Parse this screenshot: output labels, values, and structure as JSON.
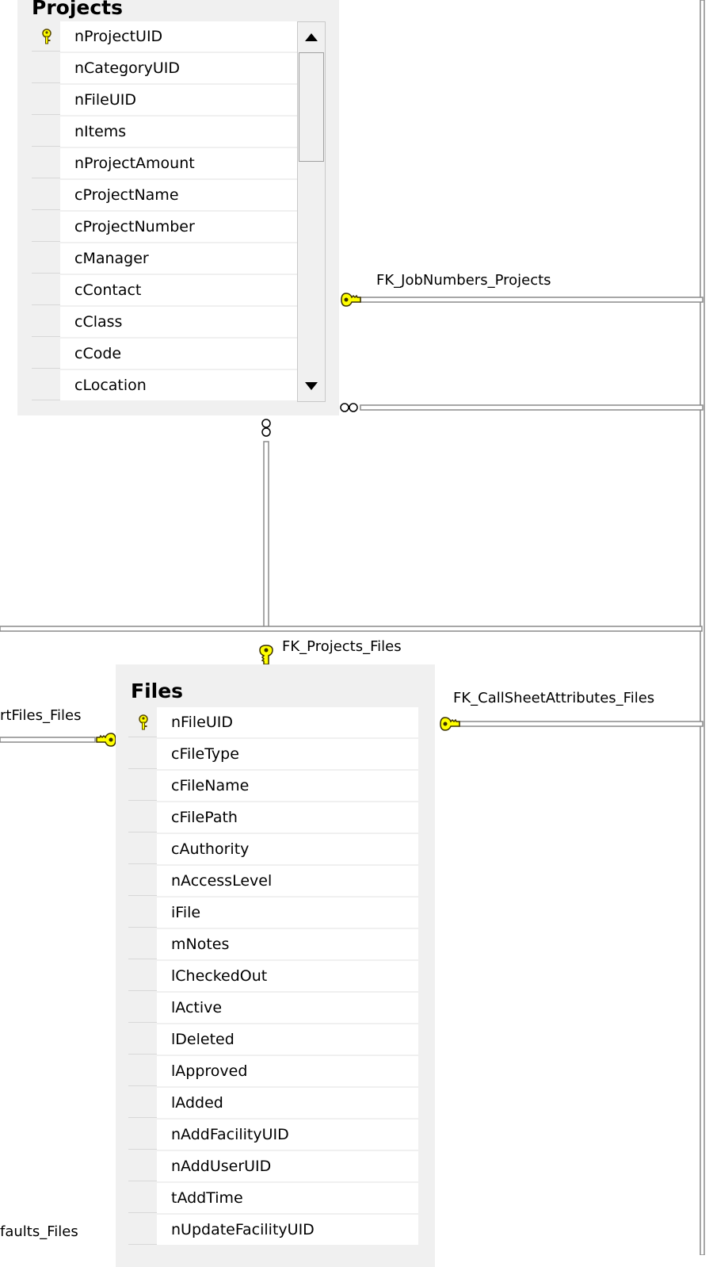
{
  "tables": {
    "projects": {
      "title": "Projects",
      "columns": [
        {
          "name": "nProjectUID",
          "key": true
        },
        {
          "name": "nCategoryUID",
          "key": false
        },
        {
          "name": "nFileUID",
          "key": false
        },
        {
          "name": "nItems",
          "key": false
        },
        {
          "name": "nProjectAmount",
          "key": false
        },
        {
          "name": "cProjectName",
          "key": false
        },
        {
          "name": "cProjectNumber",
          "key": false
        },
        {
          "name": "cManager",
          "key": false
        },
        {
          "name": "cContact",
          "key": false
        },
        {
          "name": "cClass",
          "key": false
        },
        {
          "name": "cCode",
          "key": false
        },
        {
          "name": "cLocation",
          "key": false
        }
      ]
    },
    "files": {
      "title": "Files",
      "columns": [
        {
          "name": "nFileUID",
          "key": true
        },
        {
          "name": "cFileType",
          "key": false
        },
        {
          "name": "cFileName",
          "key": false
        },
        {
          "name": "cFilePath",
          "key": false
        },
        {
          "name": "cAuthority",
          "key": false
        },
        {
          "name": "nAccessLevel",
          "key": false
        },
        {
          "name": "iFile",
          "key": false
        },
        {
          "name": "mNotes",
          "key": false
        },
        {
          "name": "lCheckedOut",
          "key": false
        },
        {
          "name": "lActive",
          "key": false
        },
        {
          "name": "lDeleted",
          "key": false
        },
        {
          "name": "lApproved",
          "key": false
        },
        {
          "name": "lAdded",
          "key": false
        },
        {
          "name": "nAddFacilityUID",
          "key": false
        },
        {
          "name": "nAddUserUID",
          "key": false
        },
        {
          "name": "tAddTime",
          "key": false
        },
        {
          "name": "nUpdateFacilityUID",
          "key": false
        }
      ]
    }
  },
  "relationships": {
    "jobnumbers_projects": "FK_JobNumbers_Projects",
    "projects_files": "FK_Projects_Files",
    "callsheetattributes_files": "FK_CallSheetAttributes_Files",
    "partial_left_files": "rtFiles_Files",
    "partial_left_defaults": "faults_Files"
  },
  "icons": {
    "primary_key": "key-icon",
    "relationship_one": "key-end-icon",
    "relationship_many": "infinity-end-icon",
    "scroll_up": "up-arrow-icon",
    "scroll_down": "down-arrow-icon"
  },
  "colors": {
    "key_yellow": "#ffff00",
    "key_outline": "#5a4a00",
    "line_gray": "#9a9a9a",
    "panel_bg": "#f0f0f0"
  }
}
